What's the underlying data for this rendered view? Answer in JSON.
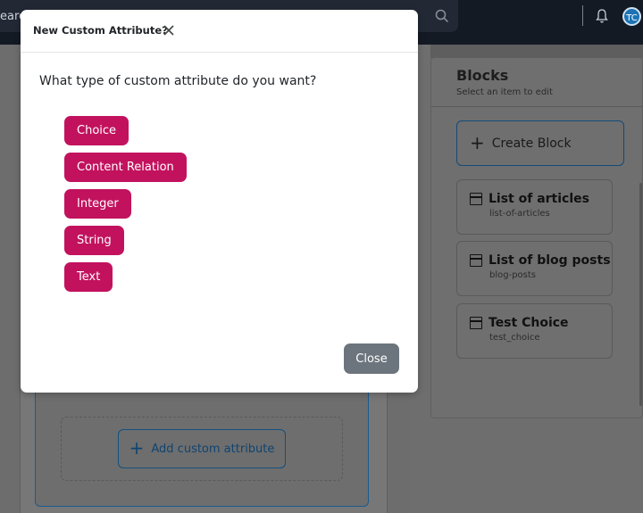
{
  "topbar": {
    "search_text": "earc",
    "icons": [
      "search-icon",
      "bell-icon"
    ],
    "avatar_initials": "TC"
  },
  "modal": {
    "title": "New Custom Attribute?",
    "question": "What type of custom attribute do you want?",
    "options": [
      "Choice",
      "Content Relation",
      "Integer",
      "String",
      "Text"
    ],
    "close_label": "Close",
    "accent_color": "#c2125e"
  },
  "background": {
    "add_attribute_label": "Add custom attribute"
  },
  "blocks": {
    "title": "Blocks",
    "subtitle": "Select an item to edit",
    "create_label": "Create Block",
    "items": [
      {
        "title": "List of articles",
        "slug": "list-of-articles"
      },
      {
        "title": "List of blog posts",
        "slug": "blog-posts"
      },
      {
        "title": "Test Choice",
        "slug": "test_choice"
      }
    ]
  }
}
